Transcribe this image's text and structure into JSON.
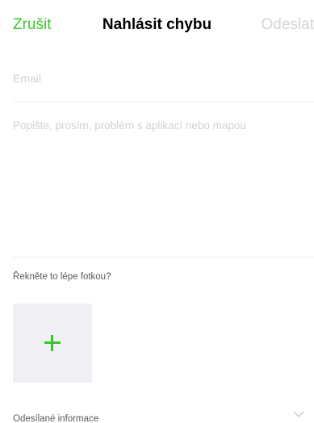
{
  "navbar": {
    "cancel_label": "Zrušit",
    "title": "Nahlásit chybu",
    "send_label": "Odeslat"
  },
  "form": {
    "email_placeholder": "Email",
    "email_value": "",
    "problem_placeholder": "Popište, prosím, problém s aplikací nebo mapou",
    "problem_value": ""
  },
  "photo": {
    "label": "Řekněte to lépe fotkou?",
    "add_icon": "plus-icon"
  },
  "sent_info": {
    "label": "Odesílané informace",
    "icon": "chevron-down-icon"
  },
  "colors": {
    "accent": "#39c52a",
    "disabled": "#d4d4d4",
    "placeholder": "#d2d2d2",
    "tile_bg": "#efeff4"
  }
}
